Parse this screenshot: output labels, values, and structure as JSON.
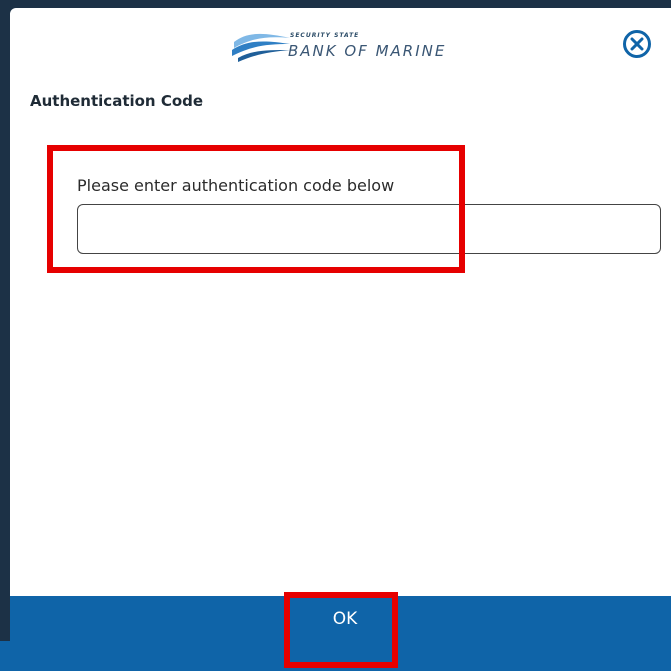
{
  "brand": {
    "small_text": "SECURITY STATE",
    "name": "BANK OF MARINE",
    "color": "#3a5674",
    "wave_colors": [
      "#7fb8e6",
      "#2f7fc4",
      "#1f5f99"
    ]
  },
  "dialog": {
    "title": "Authentication Code",
    "close_icon": "close-circle-icon"
  },
  "form": {
    "instructions": "Please enter authentication code below",
    "code_value": "",
    "code_placeholder": ""
  },
  "footer": {
    "ok_label": "OK",
    "color": "#0f64a8"
  },
  "highlight_color": "#e60000"
}
